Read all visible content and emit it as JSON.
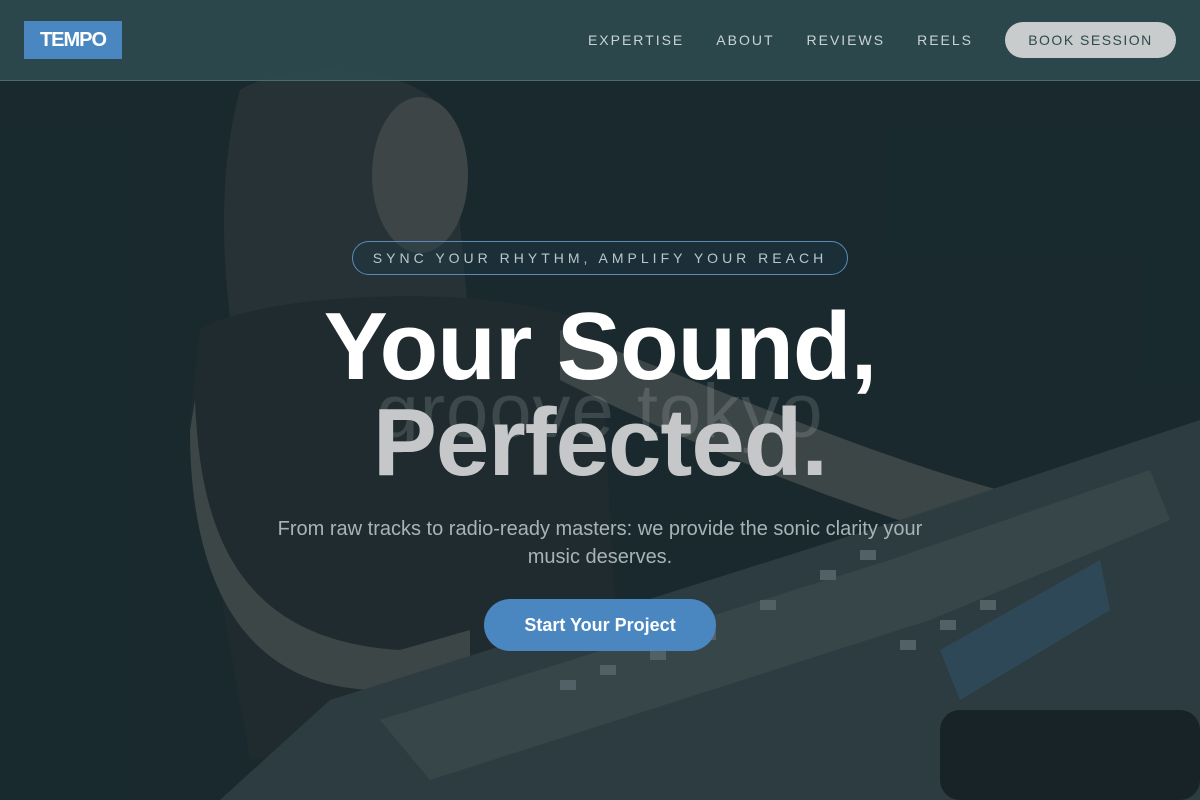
{
  "header": {
    "logo": "TEMPO",
    "nav": [
      {
        "label": "EXPERTISE"
      },
      {
        "label": "ABOUT"
      },
      {
        "label": "REVIEWS"
      },
      {
        "label": "REELS"
      }
    ],
    "book_label": "BOOK SESSION"
  },
  "hero": {
    "tagline": "SYNC YOUR RHYTHM, AMPLIFY YOUR REACH",
    "title_line1": "Your Sound,",
    "title_line2": "Perfected.",
    "background_text": "groove tokyo",
    "subtitle": "From raw tracks to radio-ready masters: we provide the sonic clarity your music deserves.",
    "cta_label": "Start Your Project"
  },
  "colors": {
    "accent": "#4a86c0",
    "header_bg": "#2c4a4e",
    "hero_bg": "#1d2c30"
  }
}
